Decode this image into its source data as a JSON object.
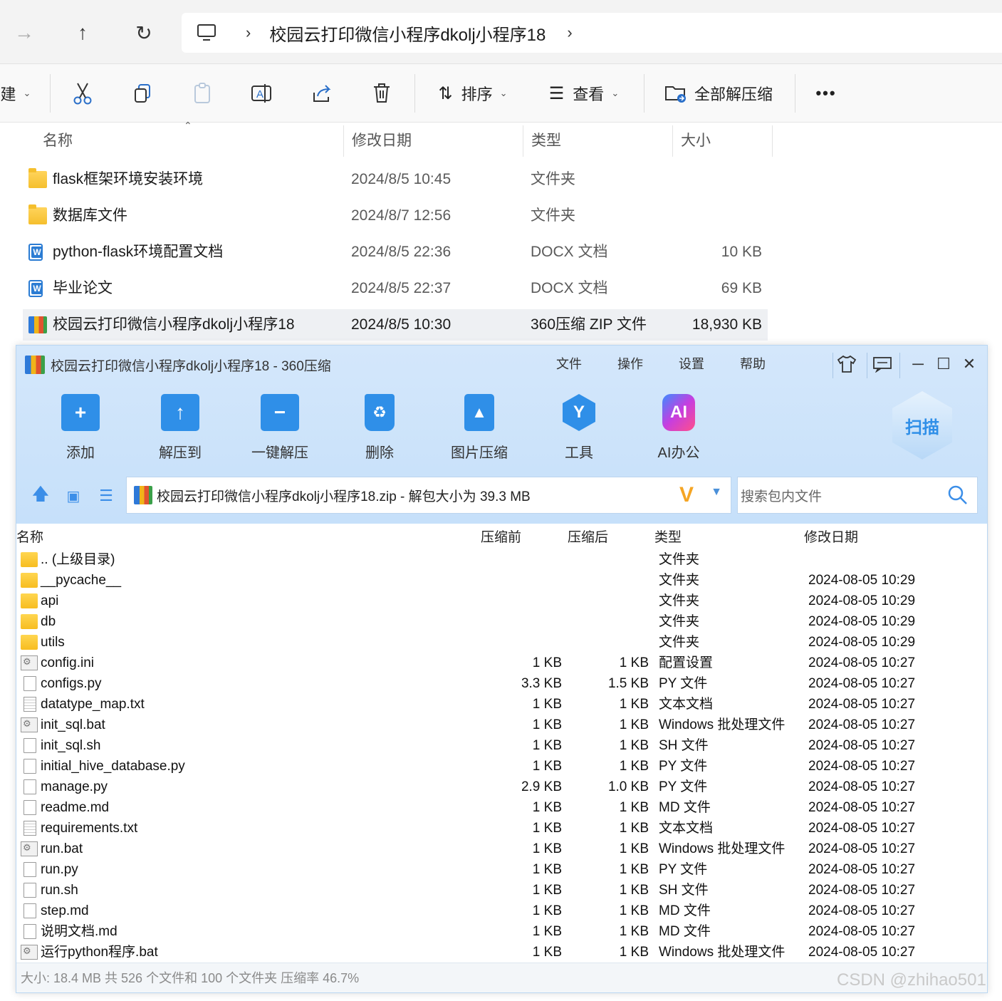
{
  "explorer": {
    "address": {
      "path": "校园云打印微信小程序dkolj小程序18"
    },
    "toolbar": {
      "new_label": "建",
      "sort_label": "排序",
      "view_label": "查看",
      "extract_all_label": "全部解压缩",
      "more_label": "•••"
    },
    "columns": {
      "name": "名称",
      "modified": "修改日期",
      "type": "类型",
      "size": "大小"
    },
    "rows": [
      {
        "name": "flask框架环境安装环境",
        "modified": "2024/8/5 10:45",
        "type": "文件夹",
        "size": "",
        "icon": "folder-icon"
      },
      {
        "name": "数据库文件",
        "modified": "2024/8/7 12:56",
        "type": "文件夹",
        "size": "",
        "icon": "folder-icon"
      },
      {
        "name": "python-flask环境配置文档",
        "modified": "2024/8/5 22:36",
        "type": "DOCX 文档",
        "size": "10 KB",
        "icon": "word-doc-icon"
      },
      {
        "name": "毕业论文",
        "modified": "2024/8/5 22:37",
        "type": "DOCX 文档",
        "size": "69 KB",
        "icon": "word-doc-icon"
      },
      {
        "name": "校园云打印微信小程序dkolj小程序18",
        "modified": "2024/8/5 10:30",
        "type": "360压缩 ZIP 文件",
        "size": "18,930 KB",
        "icon": "zip-archive-icon"
      }
    ]
  },
  "zip_window": {
    "title": "校园云打印微信小程序dkolj小程序18 - 360压缩",
    "menu": [
      "文件",
      "操作",
      "设置",
      "帮助"
    ],
    "tools": [
      {
        "label": "添加",
        "icon": "add-icon",
        "color": "#2f8fe8"
      },
      {
        "label": "解压到",
        "icon": "extract-to-icon",
        "color": "#2f8fe8"
      },
      {
        "label": "一键解压",
        "icon": "one-click-extract-icon",
        "color": "#2f8fe8"
      },
      {
        "label": "删除",
        "icon": "delete-icon",
        "color": "#2f8fe8"
      },
      {
        "label": "图片压缩",
        "icon": "image-compress-icon",
        "color": "#2f8fe8"
      },
      {
        "label": "工具",
        "icon": "tools-icon",
        "color": "#2f8fe8"
      },
      {
        "label": "AI办公",
        "icon": "ai-office-icon",
        "color": "#d33bd6"
      }
    ],
    "scan_label": "扫描",
    "path_text": "校园云打印微信小程序dkolj小程序18.zip - 解包大小为 39.3 MB",
    "search_placeholder": "搜索包内文件",
    "columns": {
      "name": "名称",
      "before": "压缩前",
      "after": "压缩后",
      "type": "类型",
      "modified": "修改日期"
    },
    "rows": [
      {
        "name": ".. (上级目录)",
        "before": "",
        "after": "",
        "type": "文件夹",
        "modified": "",
        "icon": "folder"
      },
      {
        "name": "__pycache__",
        "before": "",
        "after": "",
        "type": "文件夹",
        "modified": "2024-08-05 10:29",
        "icon": "folder"
      },
      {
        "name": "api",
        "before": "",
        "after": "",
        "type": "文件夹",
        "modified": "2024-08-05 10:29",
        "icon": "folder"
      },
      {
        "name": "db",
        "before": "",
        "after": "",
        "type": "文件夹",
        "modified": "2024-08-05 10:29",
        "icon": "folder"
      },
      {
        "name": "utils",
        "before": "",
        "after": "",
        "type": "文件夹",
        "modified": "2024-08-05 10:29",
        "icon": "folder"
      },
      {
        "name": "config.ini",
        "before": "1 KB",
        "after": "1 KB",
        "type": "配置设置",
        "modified": "2024-08-05 10:27",
        "icon": "bat"
      },
      {
        "name": "configs.py",
        "before": "3.3 KB",
        "after": "1.5 KB",
        "type": "PY 文件",
        "modified": "2024-08-05 10:27",
        "icon": "file"
      },
      {
        "name": "datatype_map.txt",
        "before": "1 KB",
        "after": "1 KB",
        "type": "文本文档",
        "modified": "2024-08-05 10:27",
        "icon": "txt"
      },
      {
        "name": "init_sql.bat",
        "before": "1 KB",
        "after": "1 KB",
        "type": "Windows 批处理文件",
        "modified": "2024-08-05 10:27",
        "icon": "bat"
      },
      {
        "name": "init_sql.sh",
        "before": "1 KB",
        "after": "1 KB",
        "type": "SH 文件",
        "modified": "2024-08-05 10:27",
        "icon": "file"
      },
      {
        "name": "initial_hive_database.py",
        "before": "1 KB",
        "after": "1 KB",
        "type": "PY 文件",
        "modified": "2024-08-05 10:27",
        "icon": "file"
      },
      {
        "name": "manage.py",
        "before": "2.9 KB",
        "after": "1.0 KB",
        "type": "PY 文件",
        "modified": "2024-08-05 10:27",
        "icon": "file"
      },
      {
        "name": "readme.md",
        "before": "1 KB",
        "after": "1 KB",
        "type": "MD 文件",
        "modified": "2024-08-05 10:27",
        "icon": "file"
      },
      {
        "name": "requirements.txt",
        "before": "1 KB",
        "after": "1 KB",
        "type": "文本文档",
        "modified": "2024-08-05 10:27",
        "icon": "txt"
      },
      {
        "name": "run.bat",
        "before": "1 KB",
        "after": "1 KB",
        "type": "Windows 批处理文件",
        "modified": "2024-08-05 10:27",
        "icon": "bat"
      },
      {
        "name": "run.py",
        "before": "1 KB",
        "after": "1 KB",
        "type": "PY 文件",
        "modified": "2024-08-05 10:27",
        "icon": "file"
      },
      {
        "name": "run.sh",
        "before": "1 KB",
        "after": "1 KB",
        "type": "SH 文件",
        "modified": "2024-08-05 10:27",
        "icon": "file"
      },
      {
        "name": "step.md",
        "before": "1 KB",
        "after": "1 KB",
        "type": "MD 文件",
        "modified": "2024-08-05 10:27",
        "icon": "file"
      },
      {
        "name": "说明文档.md",
        "before": "1 KB",
        "after": "1 KB",
        "type": "MD 文件",
        "modified": "2024-08-05 10:27",
        "icon": "file"
      },
      {
        "name": "运行python程序.bat",
        "before": "1 KB",
        "after": "1 KB",
        "type": "Windows 批处理文件",
        "modified": "2024-08-05 10:27",
        "icon": "bat"
      }
    ],
    "status": "大小: 18.4 MB 共 526 个文件和 100 个文件夹 压缩率 46.7%"
  },
  "watermark": "CSDN @zhihao501"
}
